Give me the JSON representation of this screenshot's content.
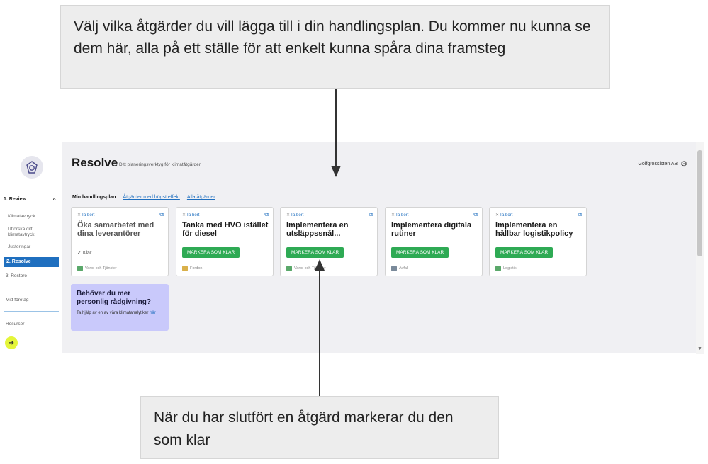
{
  "callouts": {
    "top": "Välj vilka åtgärder du vill lägga till i din handlingsplan. Du kommer nu kunna se dem här, alla på ett ställe för att enkelt kunna spåra dina framsteg",
    "bottom": "När du har slutfört en åtgärd markerar du den som klar"
  },
  "sidebar": {
    "section_review": "1. Review",
    "review_items": [
      "Klimatavtryck",
      "Utforska ditt klimatavtryck",
      "Justeringar"
    ],
    "active": "2. Resolve",
    "restore": "3. Restore",
    "company": "Mitt företag",
    "resources": "Resurser"
  },
  "header": {
    "title": "Resolve",
    "subtitle": "Ditt planeringsverktyg för klimatåtgärder",
    "company": "Golfgrossisten AB"
  },
  "tabs": [
    "Min handlingsplan",
    "Åtgärder med högst effekt",
    "Alla åtgärder"
  ],
  "cards": [
    {
      "remove": "Ta bort",
      "title": "Öka samarbetet med dina leverantörer",
      "status": "Klar",
      "category": "Varor och Tjänster"
    },
    {
      "remove": "Ta bort",
      "title": "Tanka med HVO istället för diesel",
      "button": "MARKERA SOM KLAR",
      "category": "Fordon"
    },
    {
      "remove": "Ta bort",
      "title": "Implementera en utsläppssnål...",
      "button": "MARKERA SOM KLAR",
      "category": "Varor och Tjänster"
    },
    {
      "remove": "Ta bort",
      "title": "Implementera digitala rutiner",
      "button": "MARKERA SOM KLAR",
      "category": "Avfall"
    },
    {
      "remove": "Ta bort",
      "title": "Implementera en hållbar logistikpolicy",
      "button": "MARKERA SOM KLAR",
      "category": "Logistik"
    }
  ],
  "advice": {
    "heading": "Behöver du mer personlig rådgivning?",
    "body": "Ta hjälp av en av våra klimatanalytiker",
    "link": "här"
  },
  "colors": {
    "accent": "#1f6fbf",
    "button": "#2eaa54",
    "advice_bg": "#c9c9fb",
    "help": "#e4f53a"
  }
}
